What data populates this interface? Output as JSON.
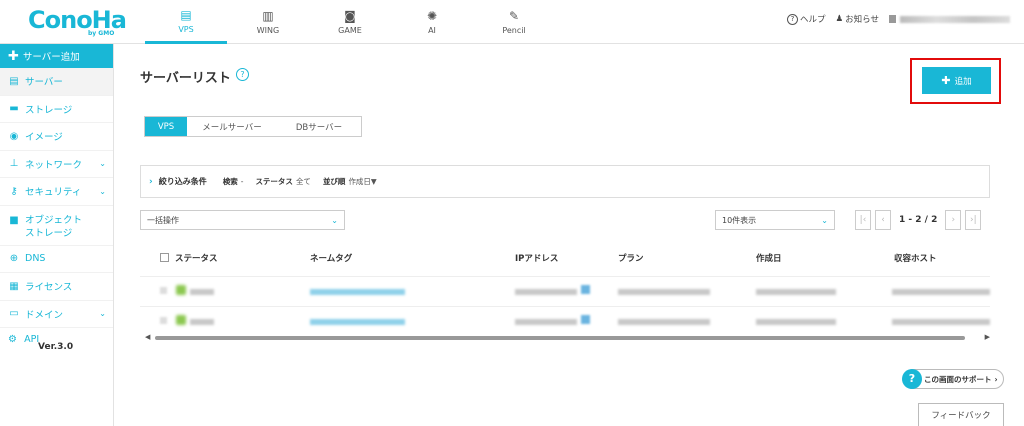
{
  "brand": {
    "logo": "ConoHa",
    "logo_sub": "by GMO"
  },
  "top_nav": [
    {
      "label": "VPS",
      "icon": "server-icon",
      "active": true
    },
    {
      "label": "WING",
      "icon": "building-icon",
      "active": false
    },
    {
      "label": "GAME",
      "icon": "gamepad-icon",
      "active": false
    },
    {
      "label": "AI",
      "icon": "brain-icon",
      "active": false
    },
    {
      "label": "Pencil",
      "icon": "pencil-icon",
      "active": false
    }
  ],
  "top_right": {
    "help": "ヘルプ",
    "notice": "お知らせ"
  },
  "sidebar": {
    "add": "サーバー追加",
    "items": [
      {
        "label": "サーバー",
        "icon": "server-icon",
        "active": true,
        "chevron": false
      },
      {
        "label": "ストレージ",
        "icon": "storage-icon",
        "active": false,
        "chevron": false
      },
      {
        "label": "イメージ",
        "icon": "image-icon",
        "active": false,
        "chevron": false
      },
      {
        "label": "ネットワーク",
        "icon": "network-icon",
        "active": false,
        "chevron": true
      },
      {
        "label": "セキュリティ",
        "icon": "key-icon",
        "active": false,
        "chevron": true
      },
      {
        "label": "オブジェクト\nストレージ",
        "icon": "folder-icon",
        "active": false,
        "chevron": false
      },
      {
        "label": "DNS",
        "icon": "globe-icon",
        "active": false,
        "chevron": false
      },
      {
        "label": "ライセンス",
        "icon": "license-icon",
        "active": false,
        "chevron": false
      },
      {
        "label": "ドメイン",
        "icon": "domain-icon",
        "active": false,
        "chevron": true
      }
    ],
    "api": "API",
    "api_version": "Ver.3.0"
  },
  "main": {
    "title": "サーバーリスト",
    "add_button": "追加",
    "tabs": [
      "VPS",
      "メールサーバー",
      "DBサーバー"
    ],
    "filter": {
      "label": "絞り込み条件",
      "search_key": "検索",
      "search_val": "-",
      "status_key": "ステータス",
      "status_val": "全て",
      "order_key": "並び順",
      "order_val": "作成日▼"
    },
    "bulk": "一括操作",
    "per_page": "10件表示",
    "page_info": "1 - 2 / 2",
    "columns": [
      "ステータス",
      "ネームタグ",
      "IPアドレス",
      "プラン",
      "作成日",
      "収容ホスト"
    ],
    "support": "この画面のサポート",
    "feedback": "フィードバック"
  },
  "colors": {
    "accent": "#19b7d6",
    "highlight": "#e20b0b"
  }
}
